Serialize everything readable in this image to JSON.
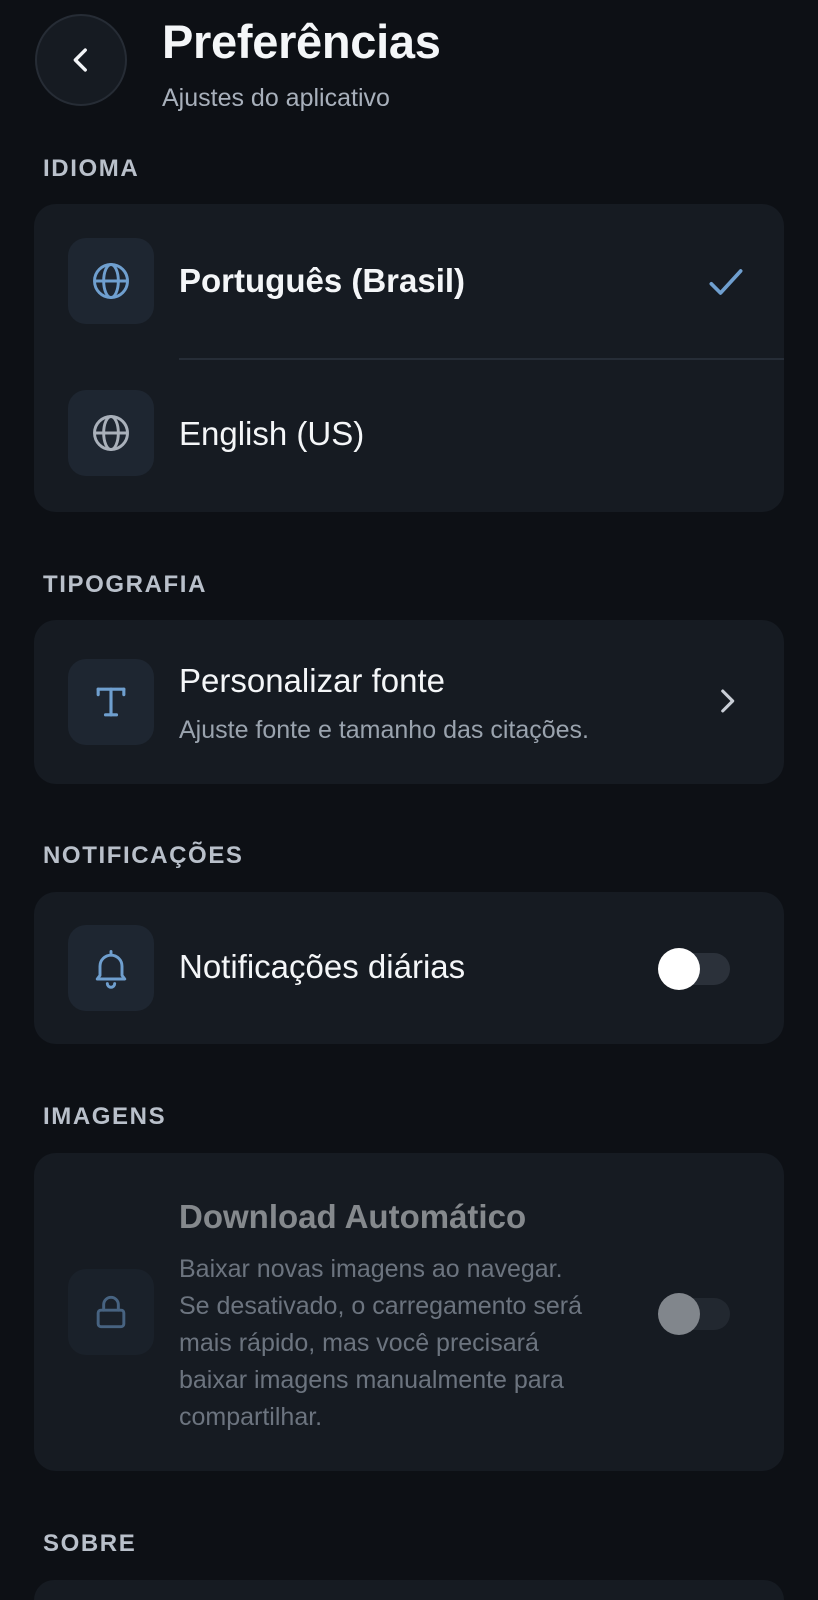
{
  "header": {
    "title": "Preferências",
    "subtitle": "Ajustes do aplicativo"
  },
  "sections": {
    "language": {
      "label": "IDIOMA",
      "options": [
        {
          "label": "Português (Brasil)",
          "selected": true
        },
        {
          "label": "English (US)",
          "selected": false
        }
      ]
    },
    "typography": {
      "label": "TIPOGRAFIA",
      "title": "Personalizar fonte",
      "description": "Ajuste fonte e tamanho das citações."
    },
    "notifications": {
      "label": "NOTIFICAÇÕES",
      "title": "Notificações diárias",
      "enabled": false
    },
    "images": {
      "label": "IMAGENS",
      "title": "Download Automático",
      "description_lines": [
        "Baixar novas imagens ao navegar.",
        "Se desativado, o carregamento será",
        "mais rápido, mas você precisará",
        "baixar imagens manualmente para",
        "compartilhar."
      ],
      "enabled": false,
      "disabled": true
    },
    "about": {
      "label": "SOBRE"
    }
  },
  "colors": {
    "accent": "#6f9fcf",
    "background": "#0d1015",
    "card": "#161b22"
  },
  "icons": {
    "back": "chevron-left-icon",
    "language": "globe-icon",
    "selected": "check-icon",
    "typography": "letter-t-icon",
    "chevron": "chevron-right-icon",
    "notifications": "bell-icon",
    "images": "lock-icon"
  }
}
